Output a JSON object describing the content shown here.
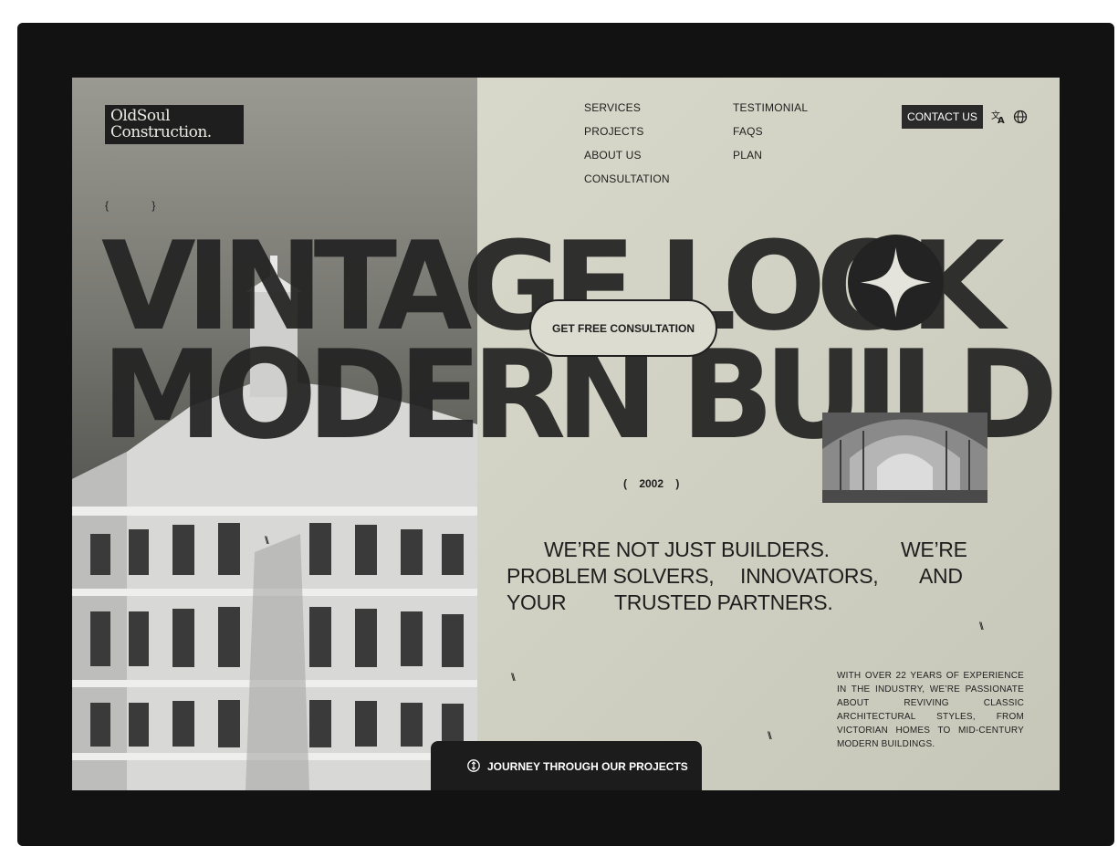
{
  "brand": {
    "logo_line1": "OldSoul",
    "logo_line2": "Construction."
  },
  "nav": {
    "col1": [
      "SERVICES",
      "PROJECTS",
      "ABOUT US",
      "CONSULTATION"
    ],
    "col2": [
      "TESTIMONIAL",
      "FAQS",
      "PLAN"
    ]
  },
  "header": {
    "contact_label": "CONTACT US",
    "translate_icon": "translate-icon",
    "globe_icon": "globe-icon"
  },
  "hero": {
    "braces": "{ }",
    "headline_line1": "VINTAGE LOOK",
    "headline_line2": "MODERN BUILD",
    "cta_label": "GET FREE CONSULTATION",
    "year": "(    2002    )",
    "tagline_words": [
      "WE’RE NOT JUST BUILDERS.",
      "WE’RE",
      "PROBLEM SOLVERS,",
      "INNOVATORS,",
      "AND",
      "YOUR",
      "TRUSTED PARTNERS."
    ],
    "slash_mark": "\\\\",
    "about_text": "WITH OVER 22 YEARS OF EXPERIENCE IN THE INDUSTRY, WE’RE PASSIONATE ABOUT REVIVING CLASSIC ARCHITECTURAL STYLES, FROM VICTORIAN HOMES TO MID-CENTURY MODERN BUILDINGS.",
    "journey_label": "JOURNEY THROUGH OUR PROJECTS",
    "journey_icon": "mouse-scroll-icon"
  },
  "colors": {
    "background": "#d6d6c9",
    "ink": "#1e1e1e",
    "frame": "#121212"
  }
}
